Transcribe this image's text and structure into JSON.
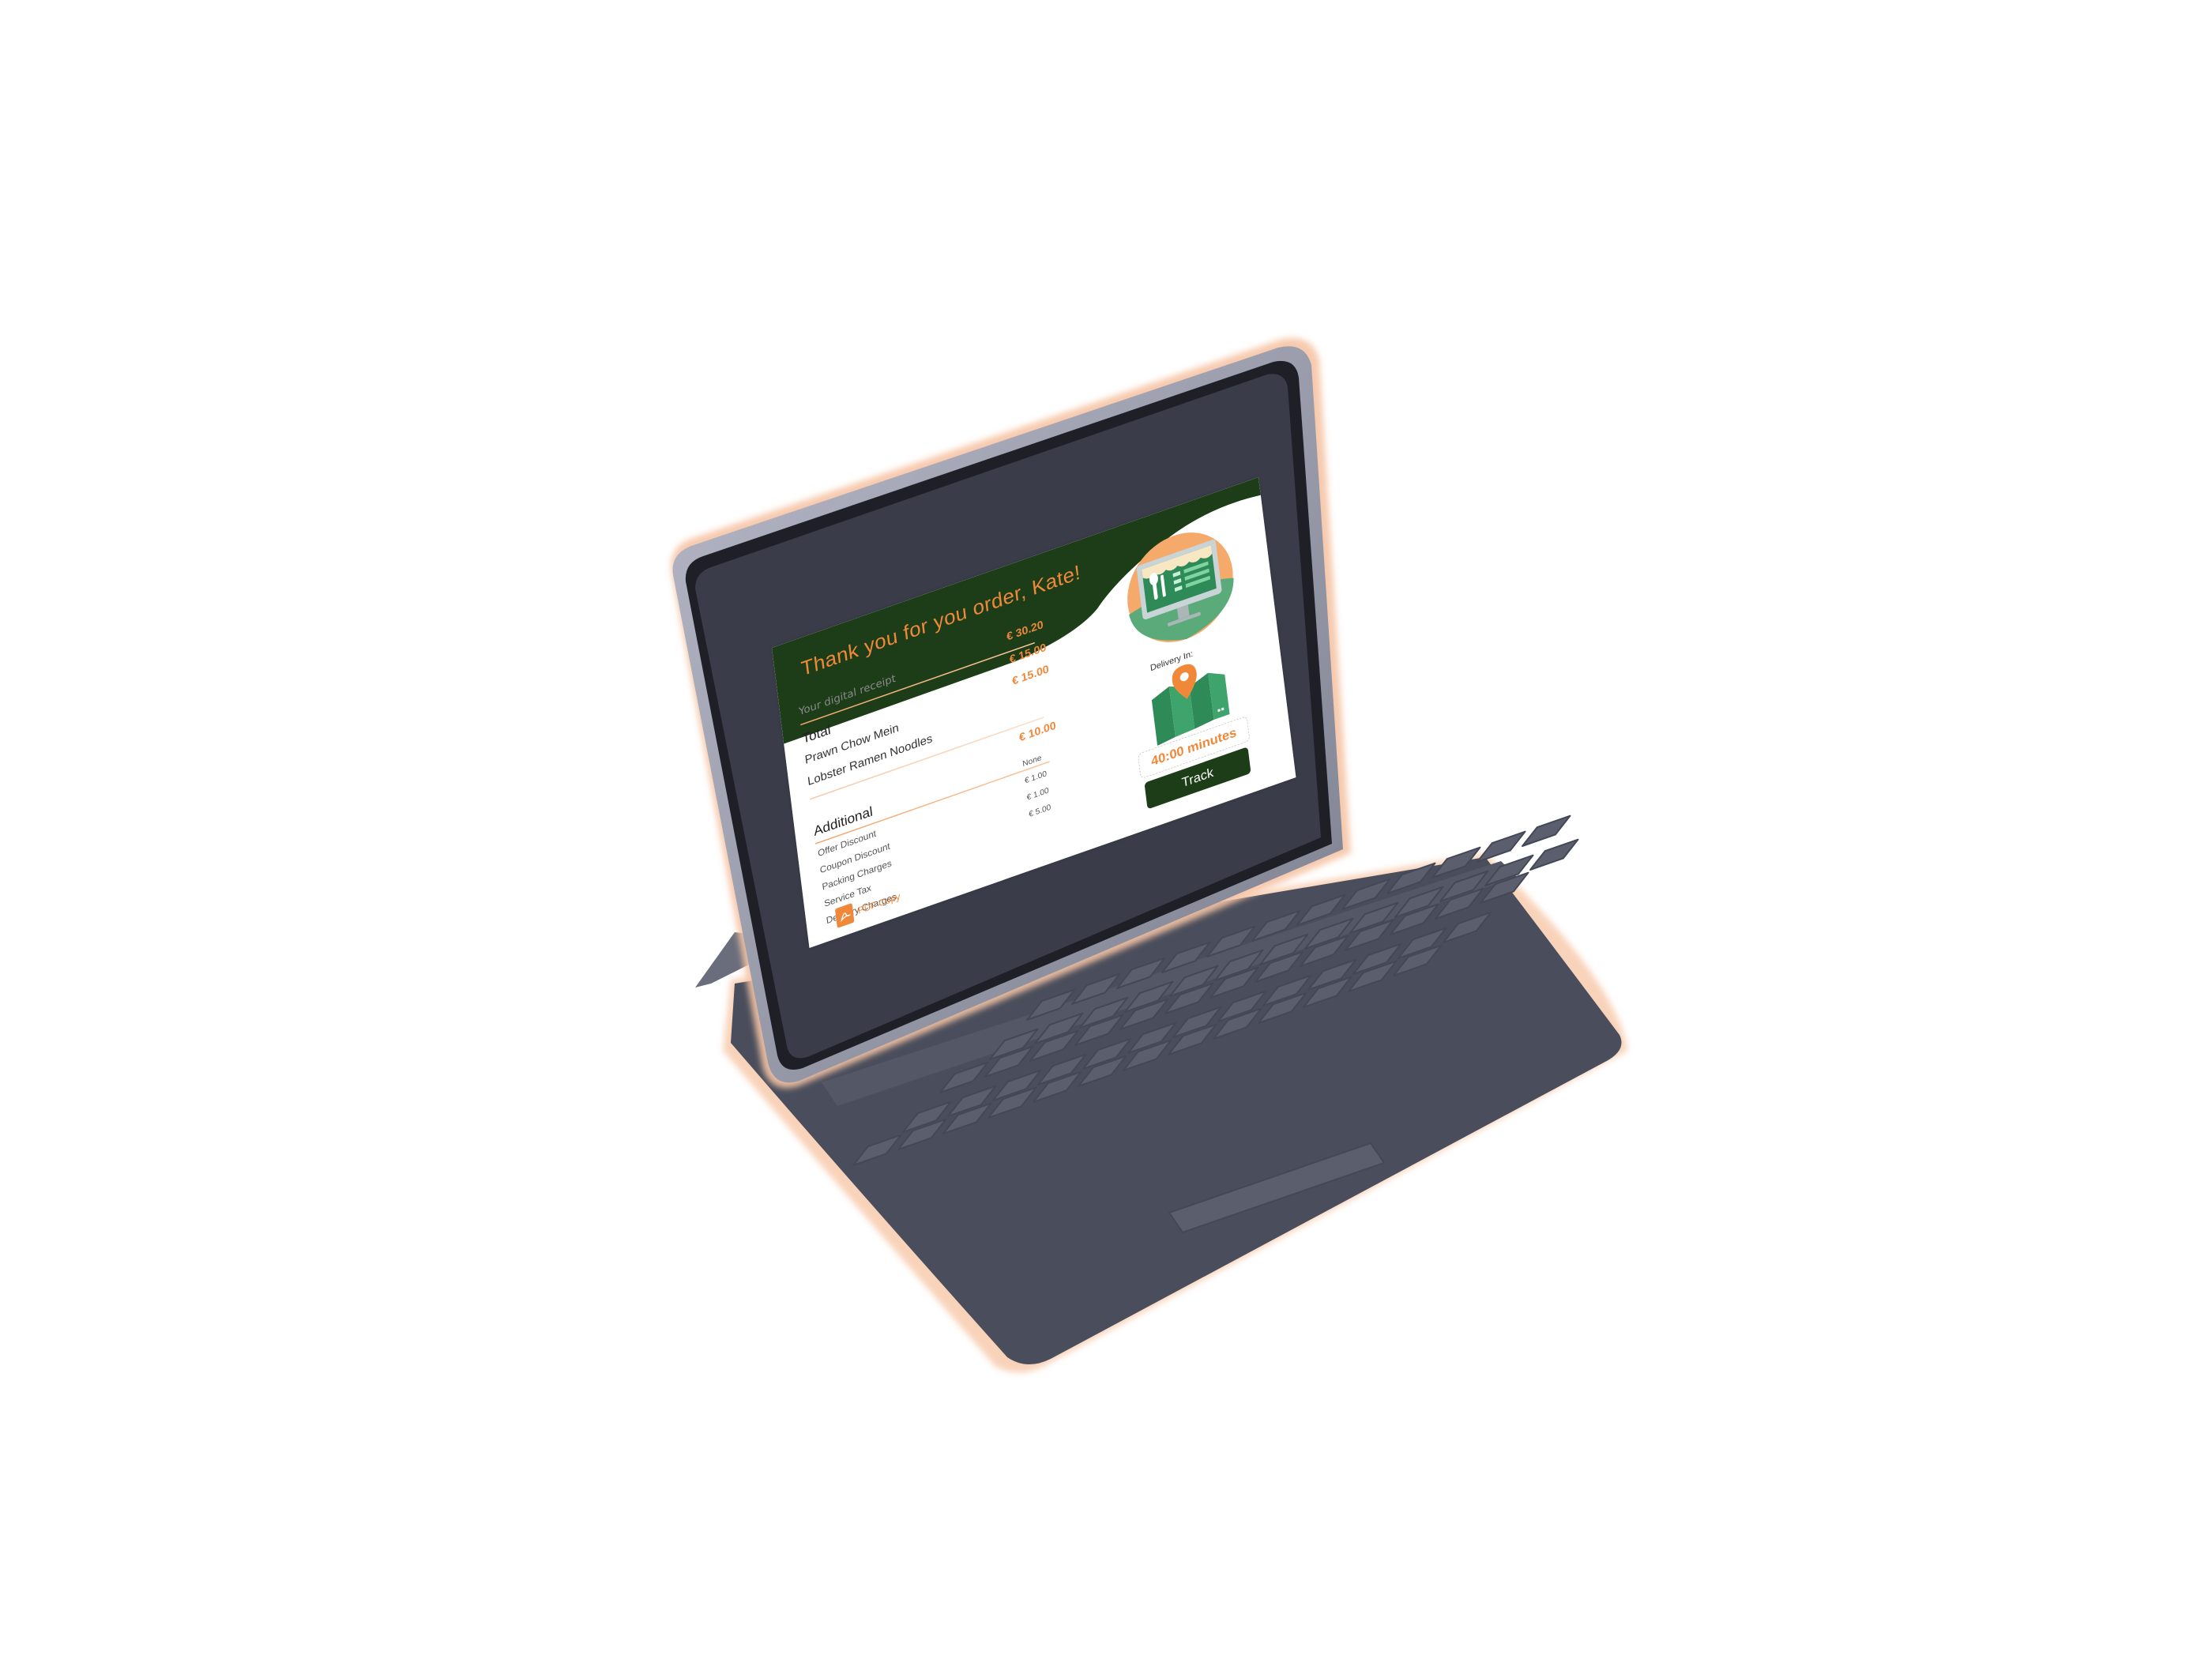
{
  "receipt": {
    "title": "Thank you for you order, Kate!",
    "subtitle": "Your digital receipt",
    "total": {
      "label": "Total",
      "amount": "€ 30.20"
    },
    "items": [
      {
        "name": "Prawn Chow Mein",
        "price": "€ 15.00"
      },
      {
        "name": "Lobster Ramen Noodles",
        "price": "€ 15.00"
      }
    ],
    "additional": {
      "label": "Additional",
      "amount": "€ 10.00",
      "lines": [
        {
          "name": "Offer Discount",
          "value": "None"
        },
        {
          "name": "Coupon Discount",
          "value": "€ 1.00"
        },
        {
          "name": "Packing Charges",
          "value": "€ 1.00"
        },
        {
          "name": "Service Tax",
          "value": "€ 5.00"
        },
        {
          "name": "Delivery Charges",
          "value": ""
        }
      ]
    },
    "pdf_link": "PDF Copy",
    "delivery": {
      "label": "Delivery In:",
      "eta": "40:00 minutes",
      "track_button": "Track"
    }
  },
  "colors": {
    "header_green": "#1c3d17",
    "accent_orange": "#f0883a",
    "illustration_green": "#2e8b57",
    "keyboard": "#4a4e5c",
    "keys": "#5b5f6d"
  },
  "icons": [
    "restaurant-monitor-icon",
    "map-pin-icon",
    "map-icon",
    "pdf-icon"
  ]
}
